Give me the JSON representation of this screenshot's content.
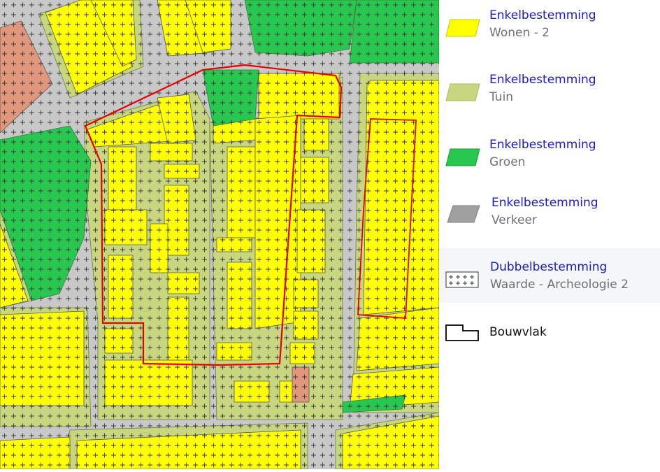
{
  "legend": {
    "items": [
      {
        "title": "Enkelbestemming",
        "subtitle": "Wonen - 2",
        "swatch": "wonen-swatch",
        "color": "#ffff00"
      },
      {
        "title": "Enkelbestemming",
        "subtitle": "Tuin",
        "swatch": "tuin-swatch",
        "color": "#c8d77f"
      },
      {
        "title": "Enkelbestemming",
        "subtitle": "Groen",
        "swatch": "groen-swatch",
        "color": "#28c850"
      },
      {
        "title": "Enkelbestemming",
        "subtitle": "Verkeer",
        "swatch": "verkeer-swatch",
        "color": "#a0a0a0"
      },
      {
        "title": "Dubbelbestemming",
        "subtitle": "Waarde - Archeologie 2",
        "swatch": "archeologie-swatch",
        "color": "#ffffff"
      },
      {
        "title": "Bouwvlak",
        "swatch": "bouwvlak-swatch",
        "color": "#000000"
      }
    ]
  },
  "map": {
    "colors": {
      "wonen": "#ffff00",
      "tuin": "#c8d77f",
      "groen": "#28c850",
      "verkeer": "#c8c8c8",
      "plangebied": "#e60000",
      "maatschappelijk": "#e0977b",
      "building_outline": "#555555"
    }
  }
}
